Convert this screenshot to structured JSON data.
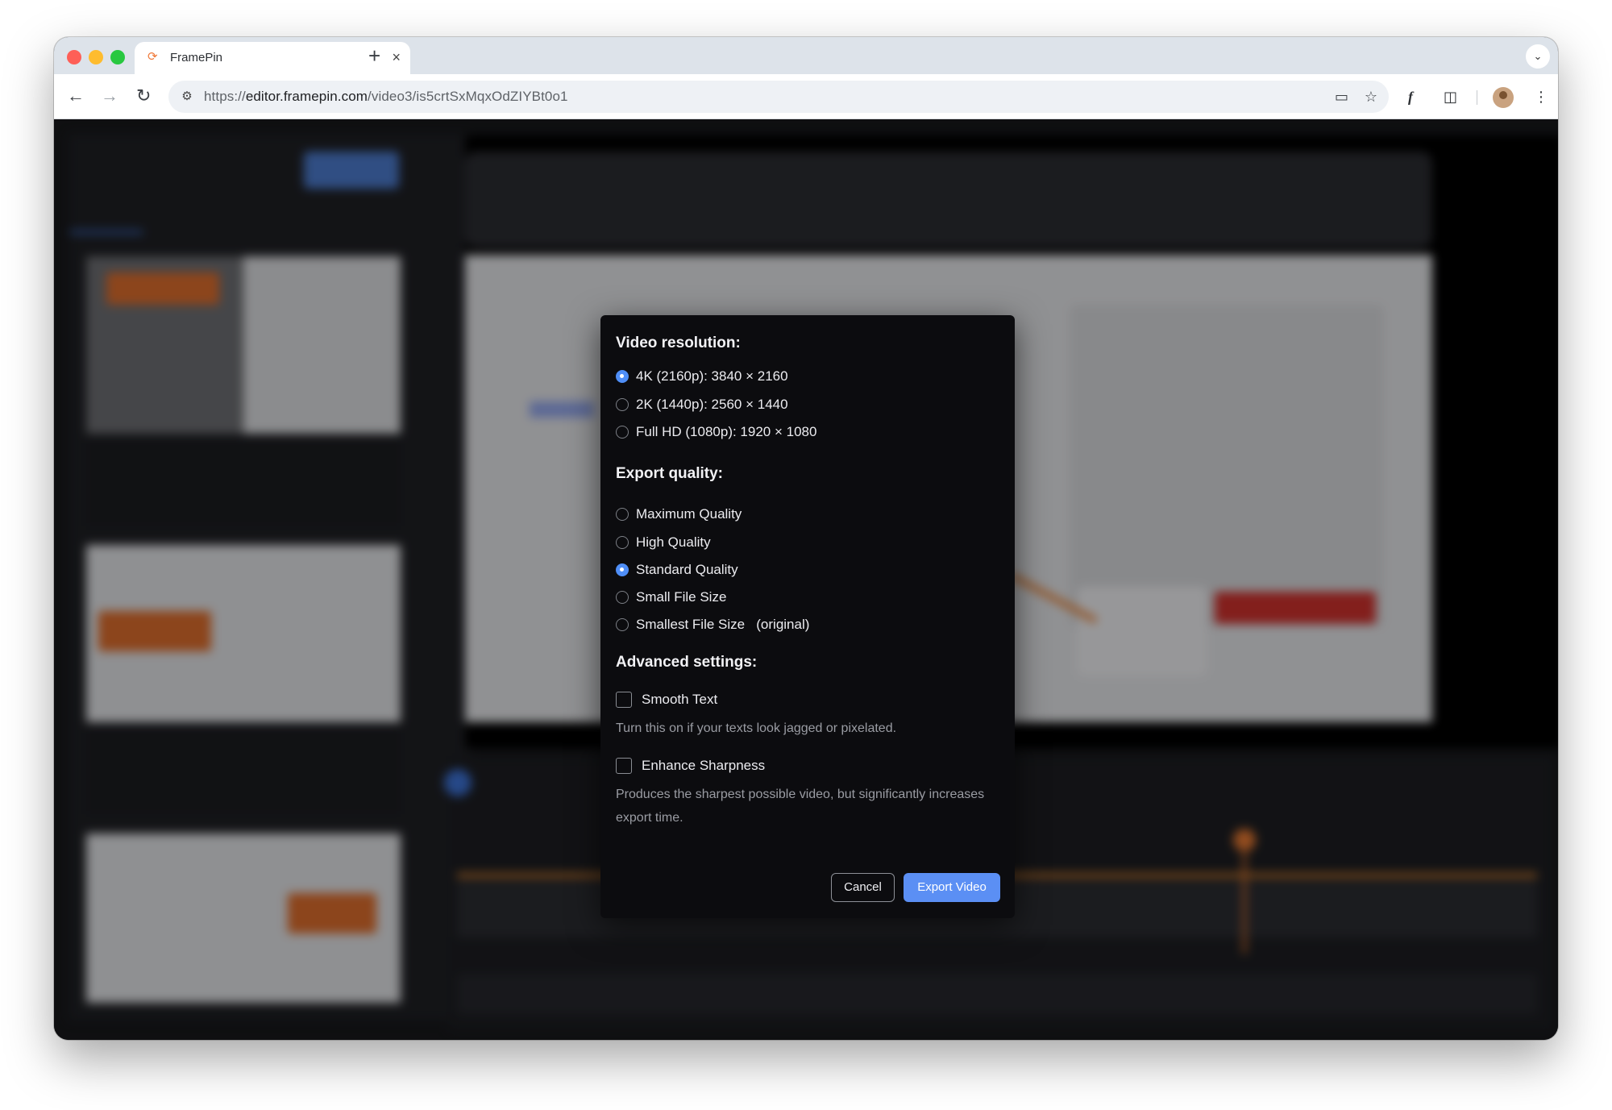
{
  "browser": {
    "tab_title": "FramePin",
    "url_scheme": "https://",
    "url_host": "editor.framepin.com",
    "url_path": "/video3/is5crtSxMqxOdZIYBt0o1",
    "new_tab_symbol": "+",
    "tab_close_symbol": "×",
    "icons": {
      "back": "arrow-left-icon",
      "forward": "arrow-right-icon",
      "reload": "reload-icon",
      "site_info": "tune-icon",
      "install": "install-app-icon",
      "bookmark": "star-icon",
      "extension": "framepin-extension-icon",
      "extensions": "puzzle-icon",
      "menu": "kebab-menu-icon"
    }
  },
  "export_dialog": {
    "resolution": {
      "title": "Video resolution:",
      "options": [
        {
          "label": "4K (2160p): 3840 × 2160",
          "checked": true
        },
        {
          "label": "2K (1440p): 2560 × 1440",
          "checked": false
        },
        {
          "label": "Full HD (1080p): 1920 × 1080",
          "checked": false
        }
      ]
    },
    "quality": {
      "title": "Export quality:",
      "options": [
        {
          "label": "Maximum Quality",
          "checked": false
        },
        {
          "label": "High Quality",
          "checked": false
        },
        {
          "label": "Standard Quality",
          "checked": true
        },
        {
          "label": "Small File Size",
          "checked": false
        },
        {
          "label": "Smallest File Size   (original)",
          "checked": false
        }
      ]
    },
    "advanced": {
      "title": "Advanced settings:",
      "smooth_text": {
        "label": "Smooth Text",
        "checked": false,
        "hint": "Turn this on if your texts look jagged or pixelated."
      },
      "enhance_sharpness": {
        "label": "Enhance Sharpness",
        "checked": false,
        "hint": "Produces the sharpest possible video, but significantly increases export time."
      }
    },
    "buttons": {
      "cancel": "Cancel",
      "export": "Export Video"
    },
    "colors": {
      "accent": "#5b8ff4",
      "background": "#0c0c0f"
    }
  }
}
